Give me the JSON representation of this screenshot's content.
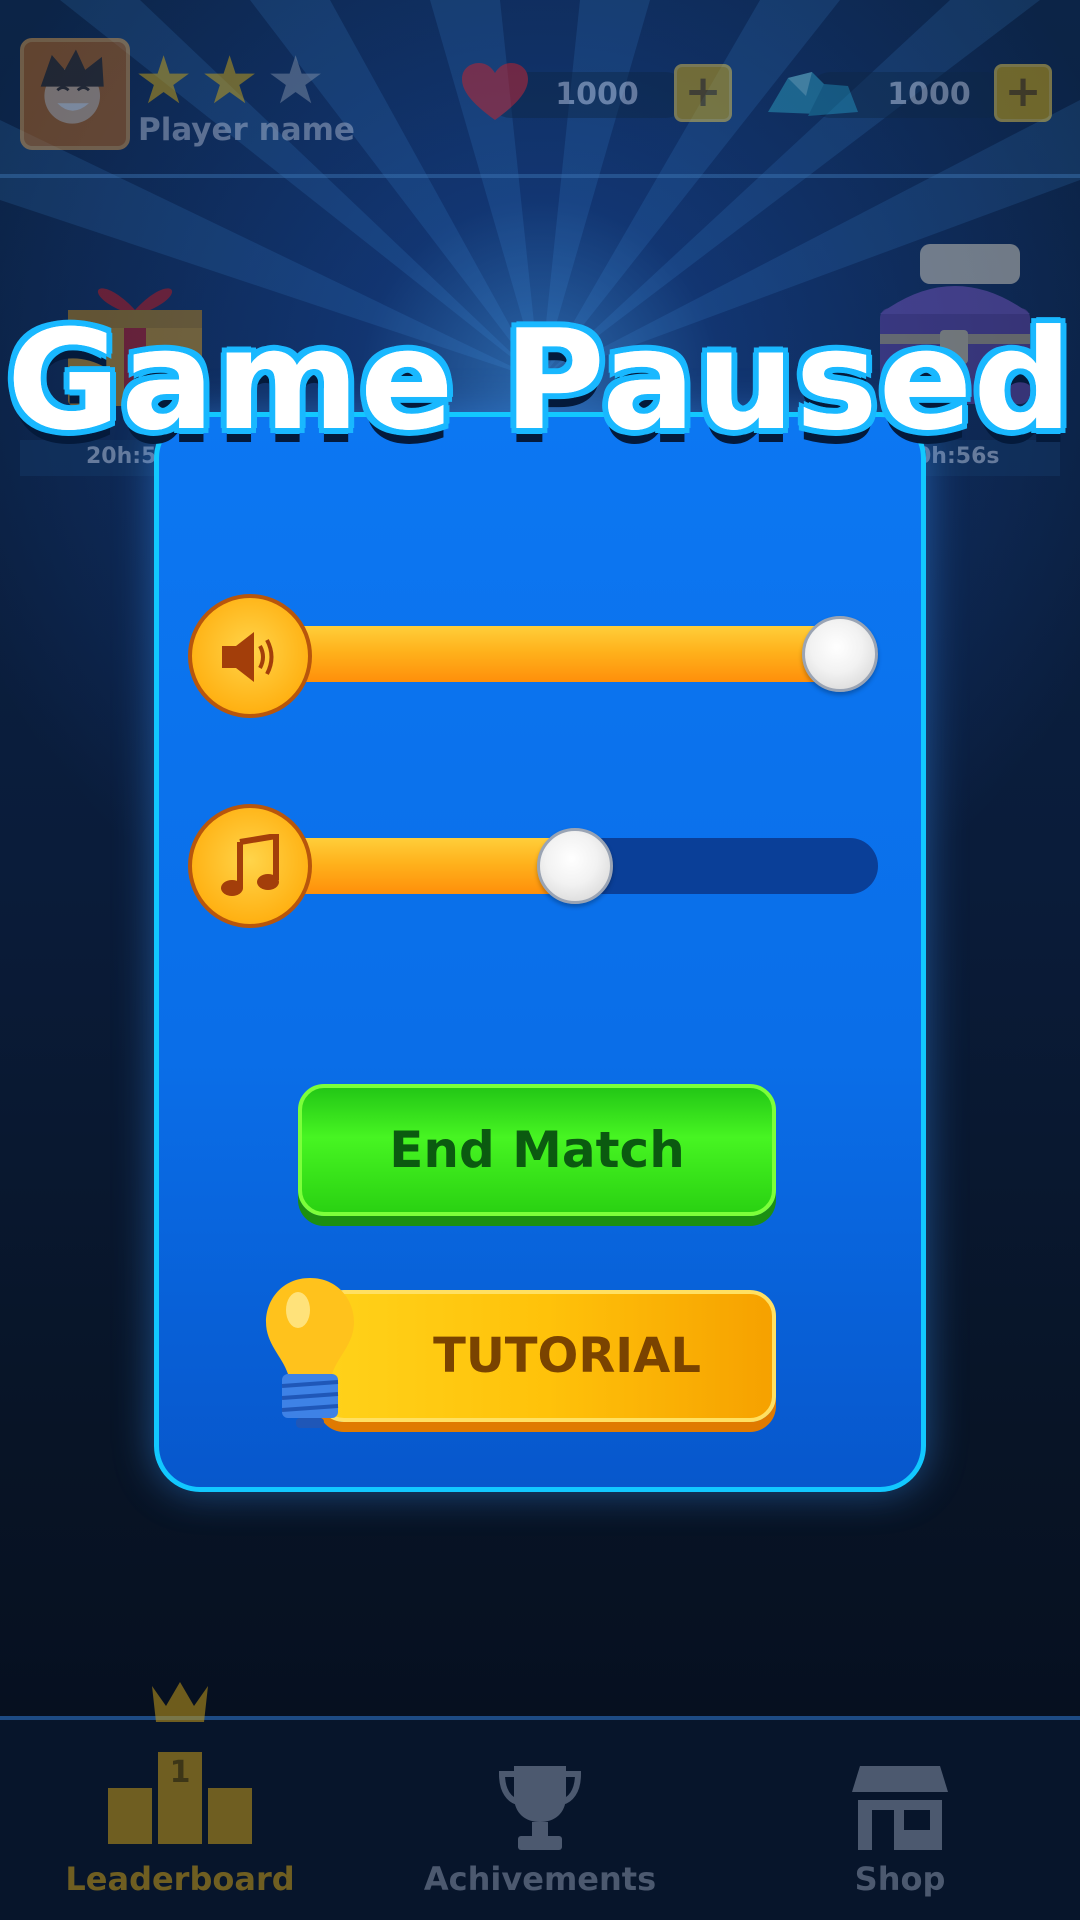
{
  "header": {
    "player_name": "Player name",
    "stars": {
      "filled": 2,
      "total": 3
    },
    "lives": {
      "value": "1000",
      "add_label": "+"
    },
    "gems": {
      "value": "1000",
      "add_label": "+"
    }
  },
  "side": {
    "left_timer": "20h:5",
    "right_timer": "0h:56s"
  },
  "dialog": {
    "title": "Game Paused",
    "sound": {
      "icon": "speaker-icon",
      "level": 1.0
    },
    "music": {
      "icon": "music-note-icon",
      "level": 0.5
    },
    "end_match_label": "End Match",
    "tutorial_label": "TUTORIAL"
  },
  "footer": {
    "tabs": [
      {
        "label": "Leaderboard",
        "icon": "podium-crown-icon"
      },
      {
        "label": "Achivements",
        "icon": "trophy-icon"
      },
      {
        "label": "Shop",
        "icon": "shop-icon"
      }
    ]
  },
  "colors": {
    "panel": "#0a6ee8",
    "panel_border": "#12c8ff",
    "slider_fill": "#ffb21c",
    "slider_track": "#0a3f98",
    "end_match_button": "#47f522",
    "tutorial_button": "#ffc20a",
    "leaderboard_tab": "#c49a1a",
    "inactive_tab": "#8591a8"
  }
}
